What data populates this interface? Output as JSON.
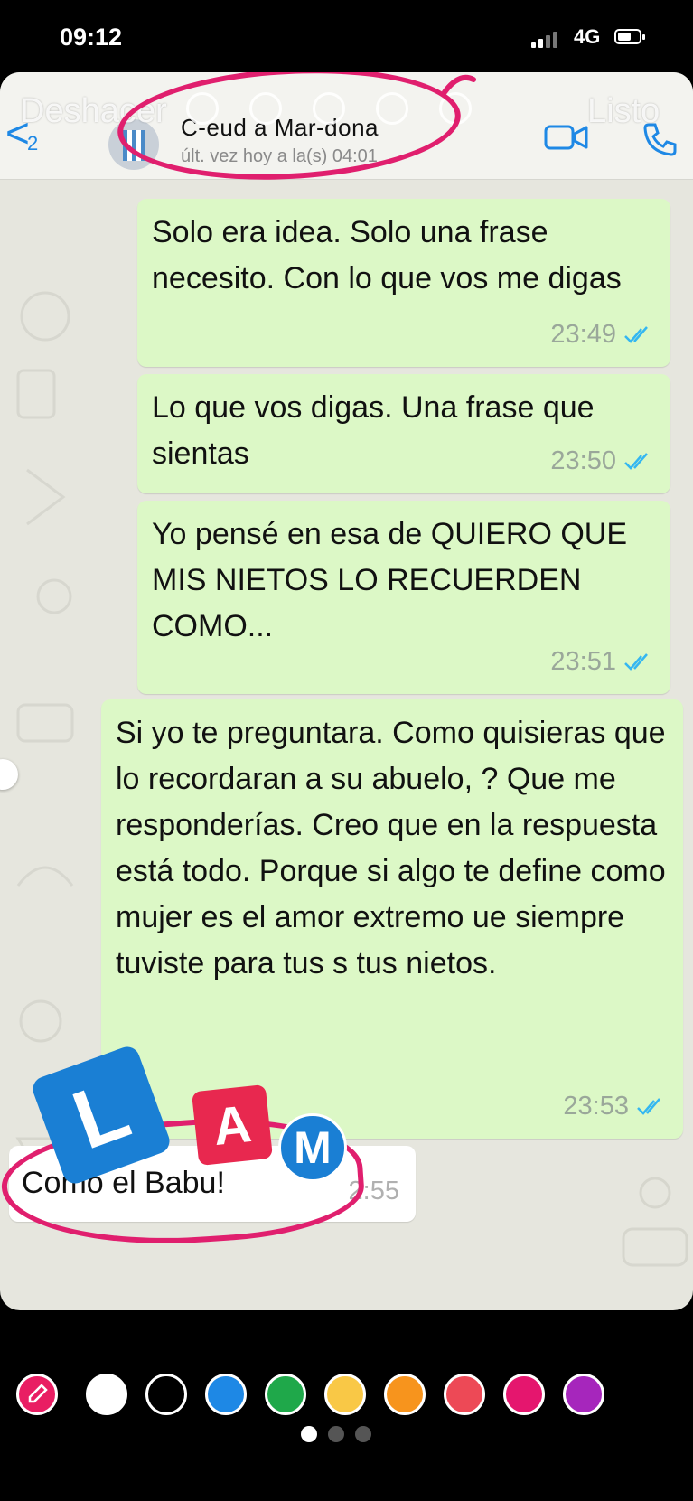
{
  "status_bar": {
    "time": "09:12",
    "network": "4G",
    "signal_bars_active": 2
  },
  "story_overlay": {
    "undo_label": "Deshacer",
    "done_label": "Listo"
  },
  "chat_header": {
    "back_count": "2",
    "contact_name": "C-eud a Mar-dona",
    "status": "últ. vez hoy a la(s) 04:01"
  },
  "messages": [
    {
      "direction": "outgoing",
      "text": "Solo era idea. Solo una frase necesito. Con lo que vos me digas",
      "time": "23:49",
      "read": true
    },
    {
      "direction": "outgoing",
      "text": "Lo que vos digas. Una frase que sientas",
      "time": "23:50",
      "read": true
    },
    {
      "direction": "outgoing",
      "text": "Yo pensé en esa de QUIERO QUE MIS NIETOS LO RECUERDEN COMO...",
      "time": "23:51",
      "read": true
    },
    {
      "direction": "outgoing",
      "text": "Si yo te preguntara. Como quisieras que lo recordaran a su abuelo, ? Que me responderías. Creo que en la respuesta está todo. Porque si algo te define como mujer es el amor extremo ue siempre tuviste para tus s tus nietos.",
      "time": "23:53",
      "read": true
    },
    {
      "direction": "incoming",
      "text": "Como el Babu!",
      "time": "2:55"
    }
  ],
  "lam_logo": {
    "letters": [
      "L",
      "A",
      "M"
    ],
    "colors": [
      "#1a7fd4",
      "#e8284f",
      "#1a7fd4"
    ]
  },
  "annotation_color": "#e01f6e",
  "color_palette": [
    "#ffffff",
    "#000000",
    "#1e88e5",
    "#1fa84a",
    "#f9c846",
    "#f7941d",
    "#ed4956",
    "#e5166e",
    "#a626bc"
  ],
  "page_indicator": {
    "pages": 3,
    "current": 1
  }
}
